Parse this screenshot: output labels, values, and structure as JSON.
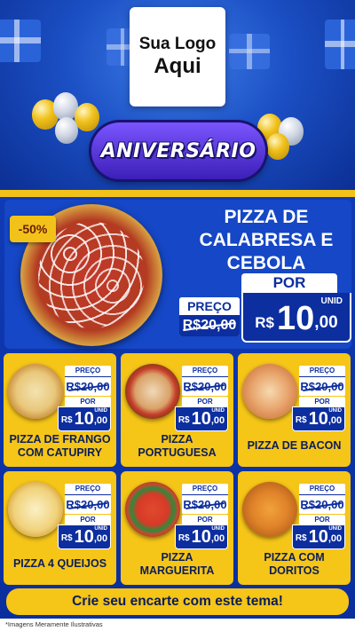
{
  "header": {
    "logo_line1": "Sua Logo",
    "logo_line2": "Aqui",
    "banner": "ANIVERSÁRIO"
  },
  "featured": {
    "discount": "-50%",
    "title": "PIZZA DE CALABRESA E CEBOLA",
    "por_label": "POR",
    "preco_label": "PREÇO",
    "old_price": "R$20,00",
    "currency": "R$",
    "price_int": "10",
    "price_dec": ",00",
    "unit": "UNID"
  },
  "products": [
    {
      "name": "PIZZA DE FRANGO COM CATUPIRY",
      "preco_label": "PREÇO",
      "old_price": "R$20,00",
      "por_label": "POR",
      "currency": "R$",
      "price_int": "10",
      "price_dec": ",00",
      "unit": "UNID"
    },
    {
      "name": "PIZZA PORTUGUESA",
      "preco_label": "PREÇO",
      "old_price": "R$20,00",
      "por_label": "POR",
      "currency": "R$",
      "price_int": "10",
      "price_dec": ",00",
      "unit": "UNID"
    },
    {
      "name": "PIZZA DE BACON",
      "preco_label": "PREÇO",
      "old_price": "R$20,00",
      "por_label": "POR",
      "currency": "R$",
      "price_int": "10",
      "price_dec": ",00",
      "unit": "UNID"
    },
    {
      "name": "PIZZA 4 QUEIJOS",
      "preco_label": "PREÇO",
      "old_price": "R$20,00",
      "por_label": "POR",
      "currency": "R$",
      "price_int": "10",
      "price_dec": ",00",
      "unit": "UNID"
    },
    {
      "name": "PIZZA MARGUERITA",
      "preco_label": "PREÇO",
      "old_price": "R$20,00",
      "por_label": "POR",
      "currency": "R$",
      "price_int": "10",
      "price_dec": ",00",
      "unit": "UNID"
    },
    {
      "name": "PIZZA COM DORITOS",
      "preco_label": "PREÇO",
      "old_price": "R$20,00",
      "por_label": "POR",
      "currency": "R$",
      "price_int": "10",
      "price_dec": ",00",
      "unit": "UNID"
    }
  ],
  "cta": "Crie seu encarte com este tema!",
  "footer_note": "*Imagens Meramente Ilustrativas",
  "colors": {
    "blue": "#0c2e9f",
    "yellow": "#f5c518",
    "white": "#ffffff"
  }
}
